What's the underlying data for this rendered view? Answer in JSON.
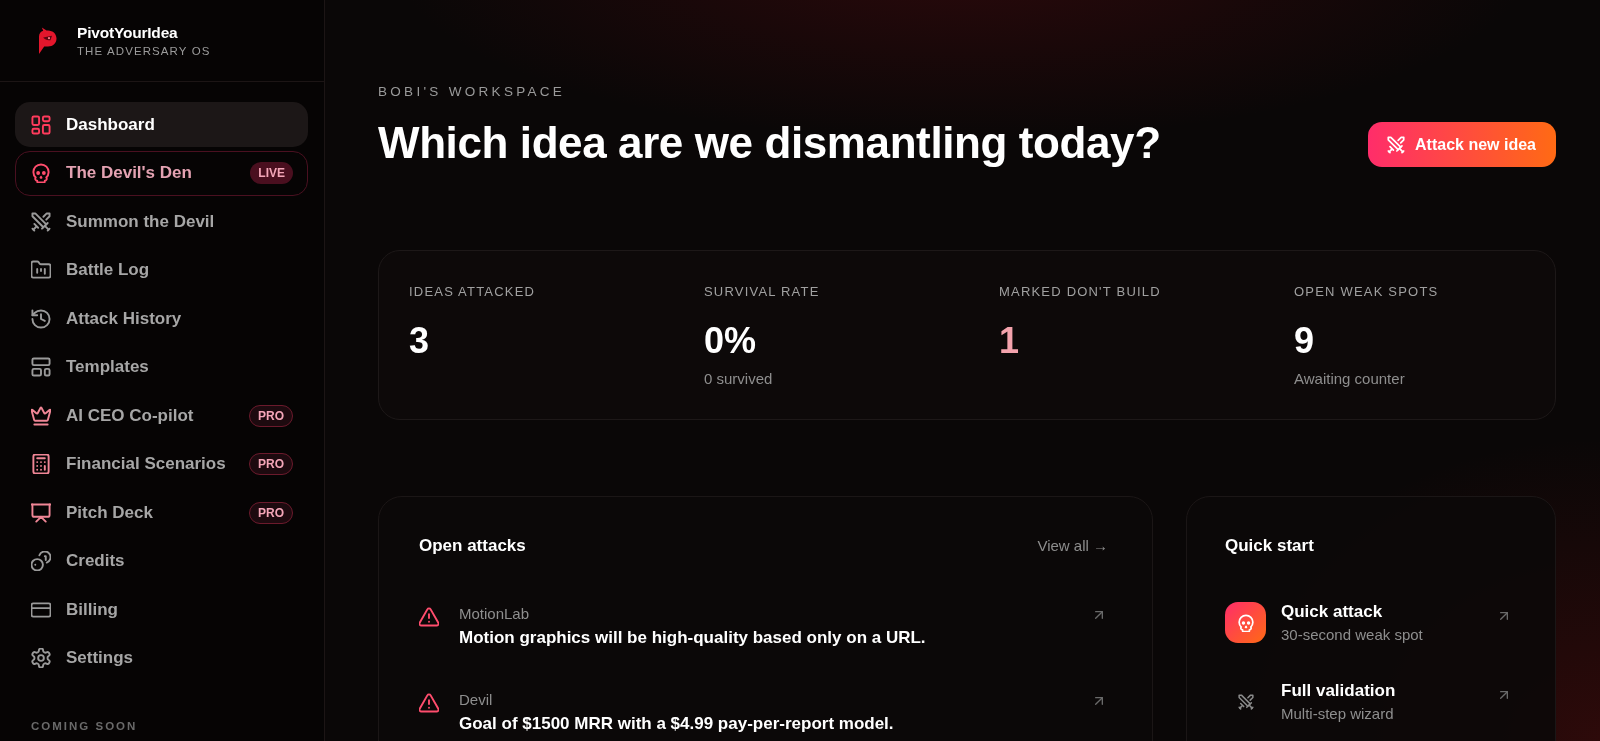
{
  "brand": {
    "name": "PivotYourIdea",
    "tagline": "THE ADVERSARY OS"
  },
  "sidebar": {
    "items": [
      {
        "label": "Dashboard",
        "kind": "standard",
        "selected": true
      },
      {
        "label": "The Devil's Den",
        "kind": "live",
        "badge": "LIVE",
        "selected": false
      },
      {
        "label": "Summon the Devil",
        "kind": "standard",
        "selected": false
      },
      {
        "label": "Battle Log",
        "kind": "standard",
        "selected": false
      },
      {
        "label": "Attack History",
        "kind": "standard",
        "selected": false
      },
      {
        "label": "Templates",
        "kind": "standard",
        "selected": false
      },
      {
        "label": "AI CEO Co-pilot",
        "kind": "pro",
        "badge": "PRO",
        "selected": false
      },
      {
        "label": "Financial Scenarios",
        "kind": "pro",
        "badge": "PRO",
        "selected": false
      },
      {
        "label": "Pitch Deck",
        "kind": "pro",
        "badge": "PRO",
        "selected": false
      },
      {
        "label": "Credits",
        "kind": "standard",
        "selected": false
      },
      {
        "label": "Billing",
        "kind": "standard",
        "selected": false
      },
      {
        "label": "Settings",
        "kind": "standard",
        "selected": false
      }
    ],
    "section_label": "COMING SOON"
  },
  "header": {
    "eyebrow": "BOBI'S WORKSPACE",
    "title": "Which idea are we dismantling today?",
    "action": "Attack new idea"
  },
  "stats": [
    {
      "label": "IDEAS ATTACKED",
      "value": "3",
      "highlighted": false
    },
    {
      "label": "SURVIVAL RATE",
      "value": "0%",
      "note": "0 survived",
      "highlighted": false
    },
    {
      "label": "MARKED DON'T BUILD",
      "value": "1",
      "highlighted": true
    },
    {
      "label": "OPEN WEAK SPOTS",
      "value": "9",
      "note": "Awaiting counter",
      "highlighted": false
    }
  ],
  "open_attacks": {
    "title": "Open attacks",
    "link": "View all →",
    "items": [
      {
        "project": "MotionLab",
        "claim": "Motion graphics will be high-quality based only on a URL."
      },
      {
        "project": "Devil",
        "claim": "Goal of $1500 MRR with a $4.99 pay-per-report model."
      }
    ]
  },
  "quick_start": {
    "title": "Quick start",
    "items": [
      {
        "title": "Quick attack",
        "subtitle": "30-second weak spot",
        "kind": "featured"
      },
      {
        "title": "Full validation",
        "subtitle": "Multi-step wizard",
        "kind": "plain"
      }
    ]
  }
}
